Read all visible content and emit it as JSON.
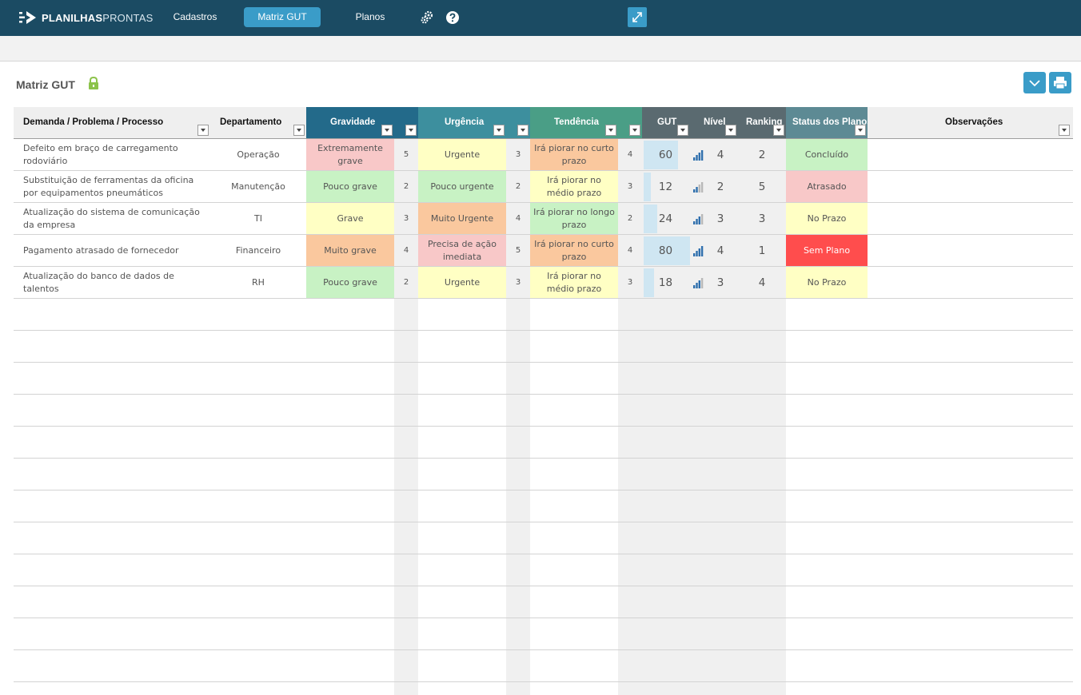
{
  "app": {
    "logo_bold": "PLANILHAS",
    "logo_light": "PRONTAS",
    "nav": {
      "cadastros": "Cadastros",
      "matriz_gut": "Matriz GUT",
      "planos": "Planos"
    },
    "accent_color": "#3a9cc8",
    "topbar_color": "#1b4b63"
  },
  "page": {
    "title": "Matriz GUT"
  },
  "table": {
    "headers": {
      "demanda": "Demanda / Problema / Processo",
      "departamento": "Departamento",
      "gravidade": "Gravidade",
      "urgencia": "Urgência",
      "tendencia": "Tendência",
      "gut": "GUT",
      "nivel": "Nível",
      "ranking": "Ranking",
      "status": "Status dos Planos",
      "observacoes": "Observações"
    },
    "rows": [
      {
        "demanda": "Defeito em braço de carregamento rodoviário",
        "departamento": "Operação",
        "gravidade": "Extremamente grave",
        "g": "5",
        "urgencia": "Urgente",
        "u": "3",
        "tendencia": "Irá piorar no curto prazo",
        "t": "4",
        "gut": "60",
        "nivel": "4",
        "ranking": "2",
        "status": "Concluído",
        "observacoes": ""
      },
      {
        "demanda": "Substituição de ferramentas da oficina por equipamentos pneumáticos",
        "departamento": "Manutenção",
        "gravidade": "Pouco grave",
        "g": "2",
        "urgencia": "Pouco urgente",
        "u": "2",
        "tendencia": "Irá piorar no médio prazo",
        "t": "3",
        "gut": "12",
        "nivel": "2",
        "ranking": "5",
        "status": "Atrasado",
        "observacoes": ""
      },
      {
        "demanda": "Atualização do sistema de comunicação da empresa",
        "departamento": "TI",
        "gravidade": "Grave",
        "g": "3",
        "urgencia": "Muito Urgente",
        "u": "4",
        "tendencia": "Irá piorar no longo prazo",
        "t": "2",
        "gut": "24",
        "nivel": "3",
        "ranking": "3",
        "status": "No Prazo",
        "observacoes": ""
      },
      {
        "demanda": "Pagamento atrasado de fornecedor",
        "departamento": "Financeiro",
        "gravidade": "Muito grave",
        "g": "4",
        "urgencia": "Precisa de ação imediata",
        "u": "5",
        "tendencia": "Irá piorar no curto prazo",
        "t": "4",
        "gut": "80",
        "nivel": "4",
        "ranking": "1",
        "status": "Sem Plano",
        "observacoes": ""
      },
      {
        "demanda": "Atualização do banco de dados de talentos",
        "departamento": "RH",
        "gravidade": "Pouco grave",
        "g": "2",
        "urgencia": "Urgente",
        "u": "3",
        "tendencia": "Irá piorar no médio prazo",
        "t": "3",
        "gut": "18",
        "nivel": "3",
        "ranking": "4",
        "status": "No Prazo",
        "observacoes": ""
      }
    ],
    "gut_max": 125,
    "score_colors": {
      "5": "#f8c8c8",
      "4": "#fac89e",
      "3": "#ffffc4",
      "2": "#c8f2c4"
    },
    "status_colors": {
      "Concluído": "#c8f2c4",
      "Atrasado": "#f8c8c8",
      "No Prazo": "#ffffc4",
      "Sem Plano": "#ff4d4d"
    },
    "header_colors": {
      "gravidade": "#236a8a",
      "urgencia": "#3d8f9e",
      "tendencia": "#4a9e86",
      "gut": "#5a6a70",
      "status": "#5d8a94"
    }
  }
}
